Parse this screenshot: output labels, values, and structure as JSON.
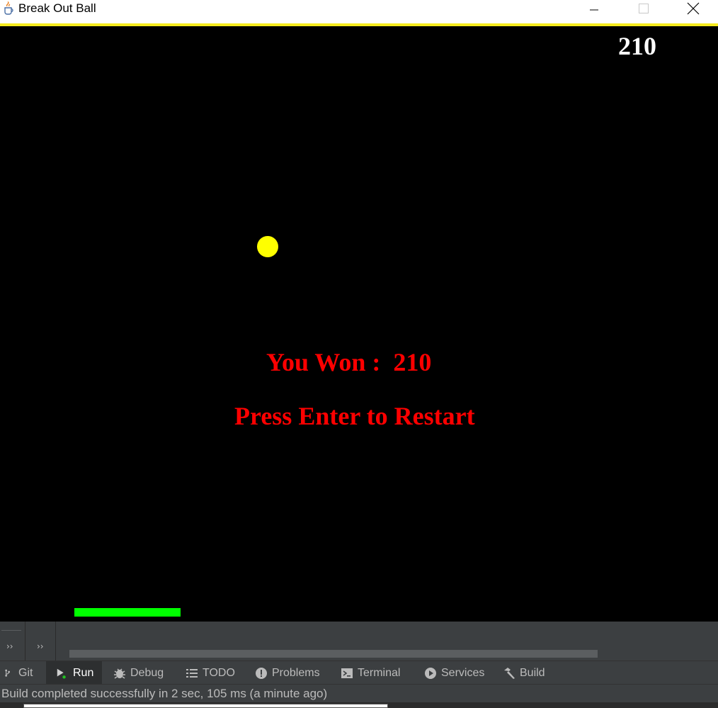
{
  "window": {
    "title": "Break Out Ball",
    "icon": "java-cup-icon",
    "border_color": "#f6ec1f"
  },
  "game": {
    "score": "210",
    "won_message": "You Won :  210",
    "restart_message": "Press Enter to Restart",
    "background_color": "#000000",
    "ball_color": "#ffff00",
    "paddle_color": "#00ff00",
    "message_color": "#ff0000",
    "score_color": "#ffffff"
  },
  "ide": {
    "chevron_1": "››",
    "chevron_2": "››",
    "tabs": [
      {
        "label": "Git",
        "icon": "git-branch-icon"
      },
      {
        "label": "Run",
        "icon": "run-icon",
        "active": true
      },
      {
        "label": "Debug",
        "icon": "bug-icon"
      },
      {
        "label": "TODO",
        "icon": "list-icon"
      },
      {
        "label": "Problems",
        "icon": "problems-icon"
      },
      {
        "label": "Terminal",
        "icon": "terminal-icon"
      },
      {
        "label": "Services",
        "icon": "services-icon"
      },
      {
        "label": "Build",
        "icon": "hammer-icon"
      }
    ],
    "status": "Build completed successfully in 2 sec, 105 ms (a minute ago)"
  }
}
